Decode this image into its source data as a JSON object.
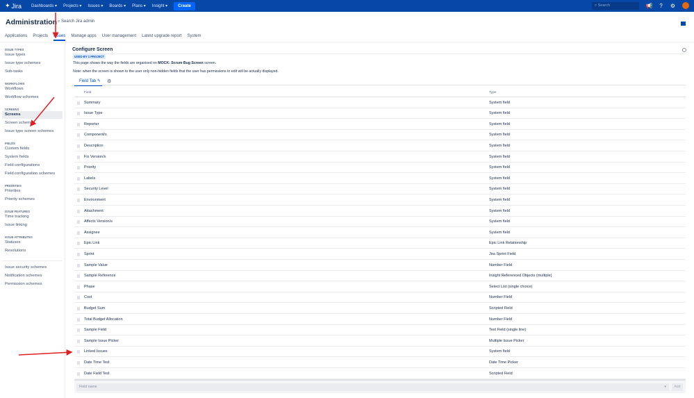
{
  "topbar": {
    "logo": "Jira",
    "nav": [
      "Dashboards ▾",
      "Projects ▾",
      "Issues ▾",
      "Boards ▾",
      "Plans ▾",
      "Insight ▾"
    ],
    "create": "Create",
    "search_placeholder": "Search"
  },
  "header": {
    "title": "Administration",
    "search": "Search Jira admin"
  },
  "tabs": [
    "Applications",
    "Projects",
    "Issues",
    "Manage apps",
    "User management",
    "Latest upgrade report",
    "System"
  ],
  "sidebar": {
    "sections": [
      {
        "title": "ISSUE TYPES",
        "items": [
          "Issue types",
          "Issue type schemes",
          "Sub-tasks"
        ]
      },
      {
        "title": "WORKFLOWS",
        "items": [
          "Workflows",
          "Workflow schemes"
        ]
      },
      {
        "title": "SCREENS",
        "items": [
          "Screens",
          "Screen schemes",
          "Issue type screen schemes"
        ]
      },
      {
        "title": "FIELDS",
        "items": [
          "Custom fields",
          "System fields",
          "Field configurations",
          "Field configuration schemes"
        ]
      },
      {
        "title": "PRIORITIES",
        "items": [
          "Priorities",
          "Priority schemes"
        ]
      },
      {
        "title": "ISSUE FEATURES",
        "items": [
          "Time tracking",
          "Issue linking"
        ]
      },
      {
        "title": "ISSUE ATTRIBUTES",
        "items": [
          "Statuses",
          "Resolutions"
        ]
      },
      {
        "title": "",
        "items": [
          "Issue security schemes",
          "Notification schemes",
          "Permission schemes"
        ]
      }
    ],
    "selected": "Screens"
  },
  "main": {
    "title": "Configure Screen",
    "badge": "USED BY 1 PROJECT",
    "desc_pre": "This page shows the way the fields are organised on ",
    "desc_bold": "MOCK: Scrum Bug Screen",
    "desc_post": " screen.",
    "note": "Note: when the screen is shown to the user only non-hidden fields that the user has permissions to edit will be actually displayed.",
    "tab": "Field Tab",
    "columns": [
      "Field",
      "Type"
    ],
    "rows": [
      [
        "Summary",
        "System field"
      ],
      [
        "Issue Type",
        "System field"
      ],
      [
        "Reporter",
        "System field"
      ],
      [
        "Component/s",
        "System field"
      ],
      [
        "Description",
        "System field"
      ],
      [
        "Fix Version/s",
        "System field"
      ],
      [
        "Priority",
        "System field"
      ],
      [
        "Labels",
        "System field"
      ],
      [
        "Security Level",
        "System field"
      ],
      [
        "Environment",
        "System field"
      ],
      [
        "Attachment",
        "System field"
      ],
      [
        "Affects Version/s",
        "System field"
      ],
      [
        "Assignee",
        "System field"
      ],
      [
        "Epic Link",
        "Epic Link Relationship"
      ],
      [
        "Sprint",
        "Jira Sprint Field"
      ],
      [
        "Sample Value",
        "Number Field"
      ],
      [
        "Sample Reference",
        "Insight Referenced Objects (multiple)"
      ],
      [
        "Phase",
        "Select List (single choice)"
      ],
      [
        "Cost",
        "Number Field"
      ],
      [
        "Budget Sum",
        "Scripted Field"
      ],
      [
        "Total Budget Allocation",
        "Number Field"
      ],
      [
        "Sample Field",
        "Text Field (single line)"
      ],
      [
        "Sample Issue Picker",
        "Multiple Issue Picker"
      ],
      [
        "Linked Issues",
        "System field"
      ],
      [
        "Date Time Test",
        "Date Time Picker"
      ],
      [
        "Date Field Test",
        "Scripted Field"
      ]
    ],
    "field_placeholder": "Field name",
    "add": "Add"
  }
}
